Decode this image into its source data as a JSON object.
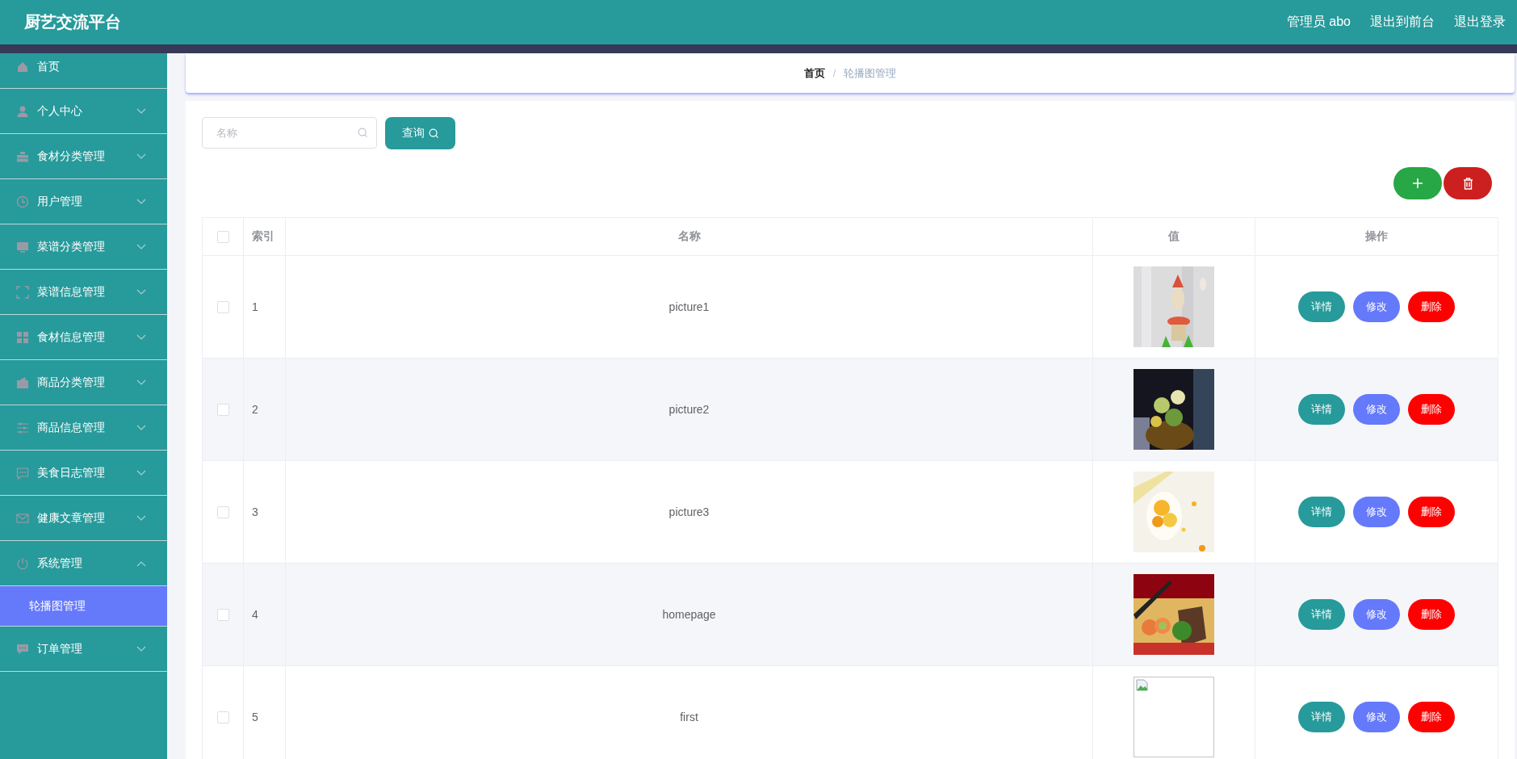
{
  "header": {
    "title": "厨艺交流平台",
    "user": "管理员 abo",
    "links": [
      "退出到前台",
      "退出登录"
    ]
  },
  "sidebar": {
    "items": [
      {
        "label": "首页",
        "kind": "link"
      },
      {
        "label": "个人中心",
        "kind": "menu",
        "expanded": false
      },
      {
        "label": "食材分类管理",
        "kind": "menu",
        "expanded": false
      },
      {
        "label": "用户管理",
        "kind": "menu",
        "expanded": false
      },
      {
        "label": "菜谱分类管理",
        "kind": "menu",
        "expanded": false
      },
      {
        "label": "菜谱信息管理",
        "kind": "menu",
        "expanded": false
      },
      {
        "label": "食材信息管理",
        "kind": "menu",
        "expanded": false
      },
      {
        "label": "商品分类管理",
        "kind": "menu",
        "expanded": false
      },
      {
        "label": "商品信息管理",
        "kind": "menu",
        "expanded": false
      },
      {
        "label": "美食日志管理",
        "kind": "menu",
        "expanded": false
      },
      {
        "label": "健康文章管理",
        "kind": "menu",
        "expanded": false
      },
      {
        "label": "系统管理",
        "kind": "menu",
        "expanded": true,
        "children": [
          {
            "label": "轮播图管理",
            "selected": true
          }
        ]
      },
      {
        "label": "订单管理",
        "kind": "menu",
        "expanded": false
      }
    ]
  },
  "breadcrumb": {
    "items": [
      "首页",
      "轮播图管理"
    ],
    "separator": "/"
  },
  "search": {
    "placeholder": "名称",
    "button": "查询"
  },
  "table": {
    "select_all_checked": false,
    "columns": [
      "索引",
      "名称",
      "值",
      "操作"
    ],
    "rows": [
      {
        "checked": false,
        "index": "1",
        "name": "picture1",
        "value": {
          "kind": "picture"
        },
        "actions": [
          "详情",
          "修改",
          "删除"
        ]
      },
      {
        "checked": false,
        "index": "2",
        "name": "picture2",
        "value": {
          "kind": "picture"
        },
        "actions": [
          "详情",
          "修改",
          "删除"
        ]
      },
      {
        "checked": false,
        "index": "3",
        "name": "picture3",
        "value": {
          "kind": "picture"
        },
        "actions": [
          "详情",
          "修改",
          "删除"
        ]
      },
      {
        "checked": false,
        "index": "4",
        "name": "homepage",
        "value": {
          "kind": "picture"
        },
        "actions": [
          "详情",
          "修改",
          "删除"
        ]
      },
      {
        "checked": false,
        "index": "5",
        "name": "first",
        "value": {
          "kind": "broken"
        },
        "actions": [
          "详情",
          "修改",
          "删除"
        ]
      }
    ]
  }
}
